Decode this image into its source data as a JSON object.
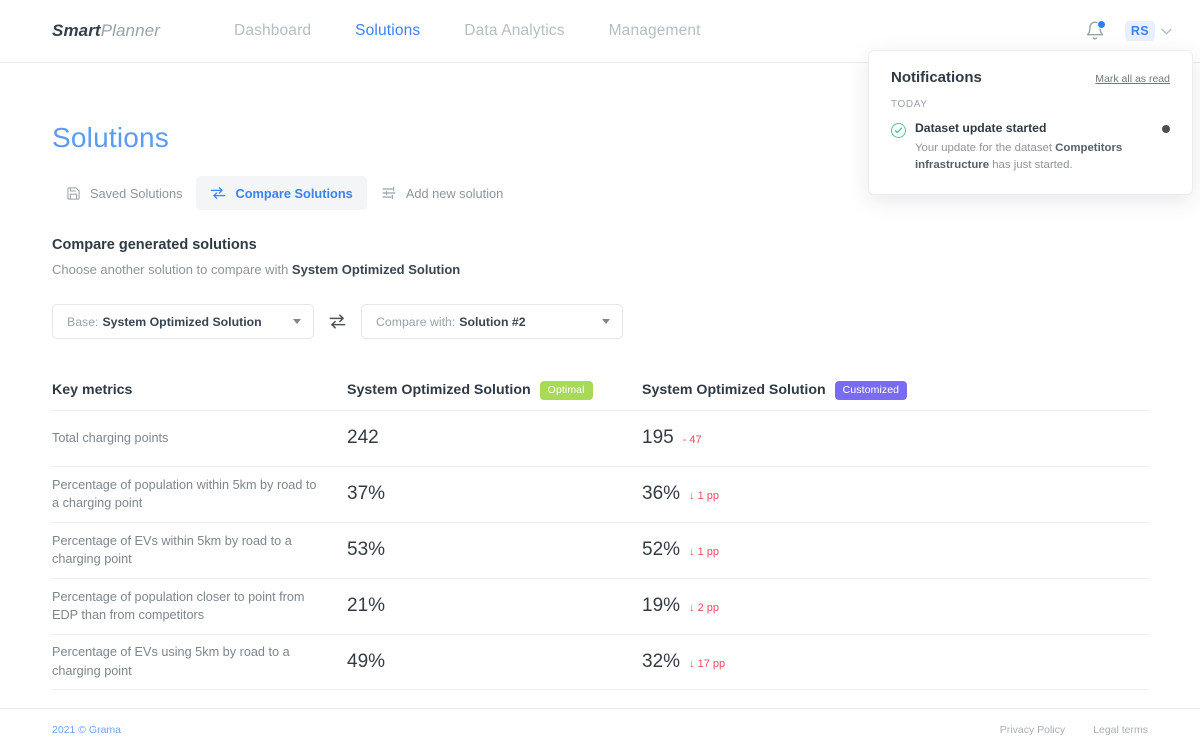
{
  "brand": {
    "bold": "Smart",
    "light": "Planner"
  },
  "nav": {
    "items": [
      {
        "label": "Dashboard",
        "active": false
      },
      {
        "label": "Solutions",
        "active": true
      },
      {
        "label": "Data Analytics",
        "active": false
      },
      {
        "label": "Management",
        "active": false
      }
    ]
  },
  "user": {
    "initials": "RS"
  },
  "notifications": {
    "title": "Notifications",
    "mark_all": "Mark all as read",
    "group_label": "TODAY",
    "items": [
      {
        "title": "Dataset update started",
        "text_before": "Your update for the dataset ",
        "text_bold": "Competitors infrastructure",
        "text_after": " has just started.",
        "unread": true
      }
    ]
  },
  "page": {
    "title": "Solutions"
  },
  "tabs": [
    {
      "label": "Saved Solutions",
      "icon": "save-icon",
      "active": false
    },
    {
      "label": "Compare Solutions",
      "icon": "compare-icon",
      "active": true
    },
    {
      "label": "Add new solution",
      "icon": "tune-icon",
      "active": false
    }
  ],
  "section": {
    "title": "Compare generated solutions",
    "subtitle_before": "Choose another solution to compare with ",
    "subtitle_bold": "System Optimized Solution"
  },
  "selectors": {
    "base": {
      "label": "Base:",
      "value": "System Optimized Solution"
    },
    "compare": {
      "label": "Compare with:",
      "value": "Solution #2"
    },
    "swap_icon": "compare-arrows-icon"
  },
  "table": {
    "headers": {
      "metric": "Key metrics",
      "solution_a": {
        "name": "System Optimized Solution",
        "badge": "Optimal",
        "badge_color": "#a8d957"
      },
      "solution_b": {
        "name": "System Optimized Solution",
        "badge": "Customized",
        "badge_color": "#7a6cf0"
      }
    },
    "rows": [
      {
        "metric": "Total charging points",
        "a": "242",
        "b": "195",
        "delta": "- 47",
        "delta_color": "#ef4b5d"
      },
      {
        "metric": "Percentage of population within 5km by road to a charging point",
        "a": "37%",
        "b": "36%",
        "delta": "↓ 1 pp",
        "delta_color": "#ef4b5d"
      },
      {
        "metric": "Percentage of EVs within 5km by road to a charging point",
        "a": "53%",
        "b": "52%",
        "delta": "↓ 1 pp",
        "delta_color": "#ef4b5d"
      },
      {
        "metric": "Percentage of population closer to point from EDP than from competitors",
        "a": "21%",
        "b": "19%",
        "delta": "↓ 2 pp",
        "delta_color": "#ef4b5d"
      },
      {
        "metric": "Percentage of EVs using 5km by road to a charging point",
        "a": "49%",
        "b": "32%",
        "delta": "↓ 17 pp",
        "delta_color": "#ef4b5d"
      }
    ]
  },
  "footer": {
    "copyright": "2021 © Grama",
    "links": [
      "Privacy Policy",
      "Legal terms"
    ]
  },
  "colors": {
    "accent": "#3b82f6",
    "title": "#5b9bf3",
    "negative": "#ef4b5d"
  }
}
